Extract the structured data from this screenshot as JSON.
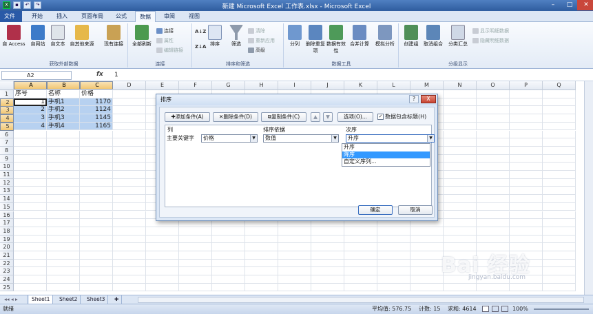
{
  "window": {
    "title": "新建 Microsoft Excel 工作表.xlsx - Microsoft Excel"
  },
  "ribbon_tabs": [
    "文件",
    "开始",
    "插入",
    "页面布局",
    "公式",
    "数据",
    "审阅",
    "视图"
  ],
  "ribbon": {
    "get_external": {
      "label": "获取外部数据",
      "buttons": [
        "自 Access",
        "自网站",
        "自文本",
        "自其他来源",
        "现有连接"
      ]
    },
    "connections": {
      "label": "连接",
      "refresh": "全部刷新",
      "items": [
        "连接",
        "属性",
        "编辑链接"
      ]
    },
    "sort_filter": {
      "label": "排序和筛选",
      "sort": "排序",
      "filter": "筛选",
      "items": [
        "清除",
        "重新应用",
        "高级"
      ]
    },
    "data_tools": {
      "label": "数据工具",
      "buttons": [
        "分列",
        "删除重复项",
        "数据有效性",
        "合并计算",
        "模拟分析"
      ]
    },
    "outline": {
      "label": "分级显示",
      "buttons": [
        "创建组",
        "取消组合",
        "分类汇总"
      ],
      "items": [
        "显示明细数据",
        "隐藏明细数据"
      ]
    }
  },
  "formula_bar": {
    "name_box": "A2",
    "fx": "fx",
    "value": "1"
  },
  "columns": [
    "A",
    "B",
    "C",
    "D",
    "E",
    "F",
    "G",
    "H",
    "I",
    "J",
    "K",
    "L",
    "M",
    "N",
    "O",
    "P",
    "Q"
  ],
  "rows": [
    "1",
    "2",
    "3",
    "4",
    "5",
    "6",
    "7",
    "8",
    "9",
    "10",
    "11",
    "12",
    "13",
    "14",
    "15",
    "16",
    "17",
    "18",
    "19",
    "20",
    "21",
    "22",
    "23",
    "24",
    "25"
  ],
  "table": {
    "headers": [
      "序号",
      "名称",
      "价格"
    ],
    "data": [
      [
        "1",
        "手机1",
        "1170"
      ],
      [
        "2",
        "手机2",
        "1124"
      ],
      [
        "3",
        "手机3",
        "1145"
      ],
      [
        "4",
        "手机4",
        "1165"
      ]
    ]
  },
  "dialog": {
    "title": "排序",
    "help": "?",
    "close": "X",
    "add_level": "添加条件(A)",
    "delete_level": "删除条件(D)",
    "copy_level": "复制条件(C)",
    "options": "选项(O)...",
    "has_header": "数据包含标题(H)",
    "col_header": "列",
    "sort_on_header": "排序依据",
    "order_header": "次序",
    "row_label": "主要关键字",
    "column_value": "价格",
    "sort_on_value": "数值",
    "order_value": "升序",
    "order_options": [
      "升序",
      "降序",
      "自定义序列..."
    ],
    "ok": "确定",
    "cancel": "取消"
  },
  "sheets": [
    "Sheet1",
    "Sheet2",
    "Sheet3"
  ],
  "status": {
    "ready": "就绪",
    "average": "平均值: 576.75",
    "count": "计数: 15",
    "sum": "求和: 4614",
    "zoom": "100%"
  },
  "watermark": {
    "main": "Bai 经验",
    "sub": "jingyan.baidu.com"
  }
}
